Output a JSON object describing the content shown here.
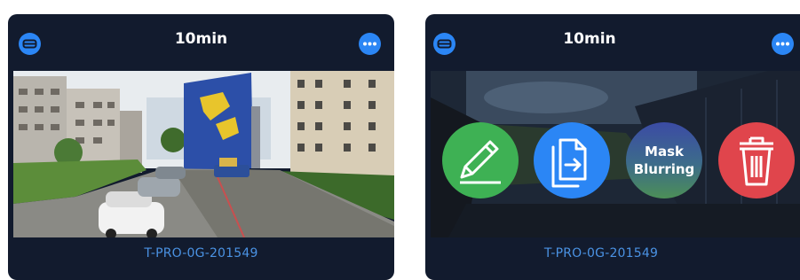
{
  "cards": [
    {
      "duration": "10min",
      "device_id": "T-PRO-0G-201549",
      "left_icon": "device-icon",
      "right_icon": "more-options-icon",
      "photo": "street-panorama"
    },
    {
      "duration": "10min",
      "device_id": "T-PRO-0G-201549",
      "left_icon": "device-icon",
      "right_icon": "more-options-icon",
      "photo": "dimmed-panorama",
      "actions": [
        {
          "icon": "pencil-icon",
          "color": "#3eb154"
        },
        {
          "icon": "export-icon",
          "color": "#2b86f5"
        },
        {
          "label_line1": "Mask",
          "label_line2": "Blurring"
        },
        {
          "icon": "trash-icon",
          "color": "#e0454c"
        }
      ]
    }
  ],
  "colors": {
    "card_bg": "#121b2e",
    "accent_blue": "#2b86f5",
    "footer_text": "#4a92e3"
  }
}
